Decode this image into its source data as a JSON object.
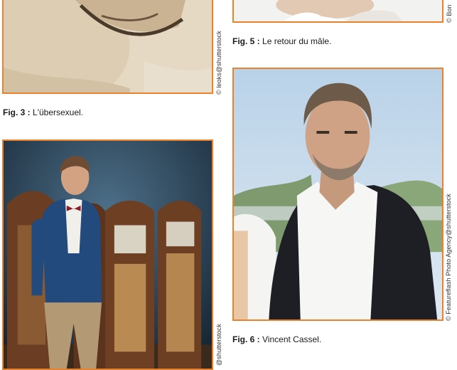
{
  "figures": [
    {
      "id": "fig3",
      "label": "Fig. 3 :",
      "caption": "L'übersexuel.",
      "credit": "© leoks@shutterstock"
    },
    {
      "id": "fig5",
      "label": "Fig. 5 :",
      "caption": "Le retour du mâle.",
      "credit": "© Bon"
    },
    {
      "id": "fig6",
      "label": "Fig. 6 :",
      "caption": "Vincent Cassel.",
      "credit": "© Featureflash Photo Agency@shutterstock"
    },
    {
      "id": "fig4",
      "label": "",
      "caption": "",
      "credit": "@shutterstock"
    }
  ],
  "colors": {
    "frame": "#e8822c",
    "text": "#1a1a1a"
  }
}
